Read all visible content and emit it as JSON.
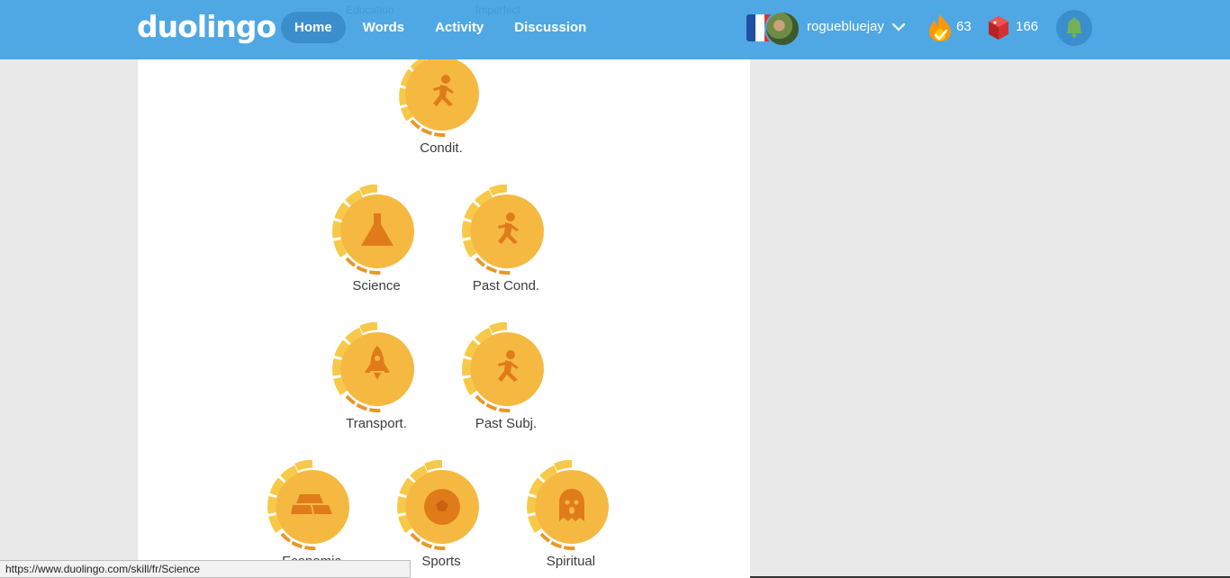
{
  "header": {
    "logo": "duolingo",
    "nav": [
      {
        "label": "Home",
        "active": true
      },
      {
        "label": "Words",
        "active": false
      },
      {
        "label": "Activity",
        "active": false
      },
      {
        "label": "Discussion",
        "active": false
      }
    ],
    "hidden_labels": [
      "Education",
      "Imperfect"
    ],
    "username": "roguebluejay",
    "streak": "63",
    "gems": "166",
    "icons": {
      "flag": "french-flag-icon",
      "streak": "flame-icon",
      "gems": "gem-icon",
      "notifications": "bell-icon",
      "menu": "chevron-down-icon"
    }
  },
  "skills": [
    {
      "label": "Condit.",
      "icon": "runner-icon"
    },
    {
      "label": "Science",
      "icon": "flask-icon"
    },
    {
      "label": "Past Cond.",
      "icon": "runner-icon"
    },
    {
      "label": "Transport.",
      "icon": "rocket-icon"
    },
    {
      "label": "Past Subj.",
      "icon": "runner-icon"
    },
    {
      "label": "Economic",
      "icon": "gold-bars-icon"
    },
    {
      "label": "Sports",
      "icon": "soccer-ball-icon"
    },
    {
      "label": "Spiritual",
      "icon": "ghost-icon"
    }
  ],
  "statusbar": {
    "url": "https://www.duolingo.com/skill/fr/Science"
  },
  "colors": {
    "header": "#4fa8e3",
    "nav_active": "#3b8ecc",
    "gold": "#f5b942",
    "gold_ring": "#f7c948",
    "icon_orange": "#e07b1a"
  }
}
